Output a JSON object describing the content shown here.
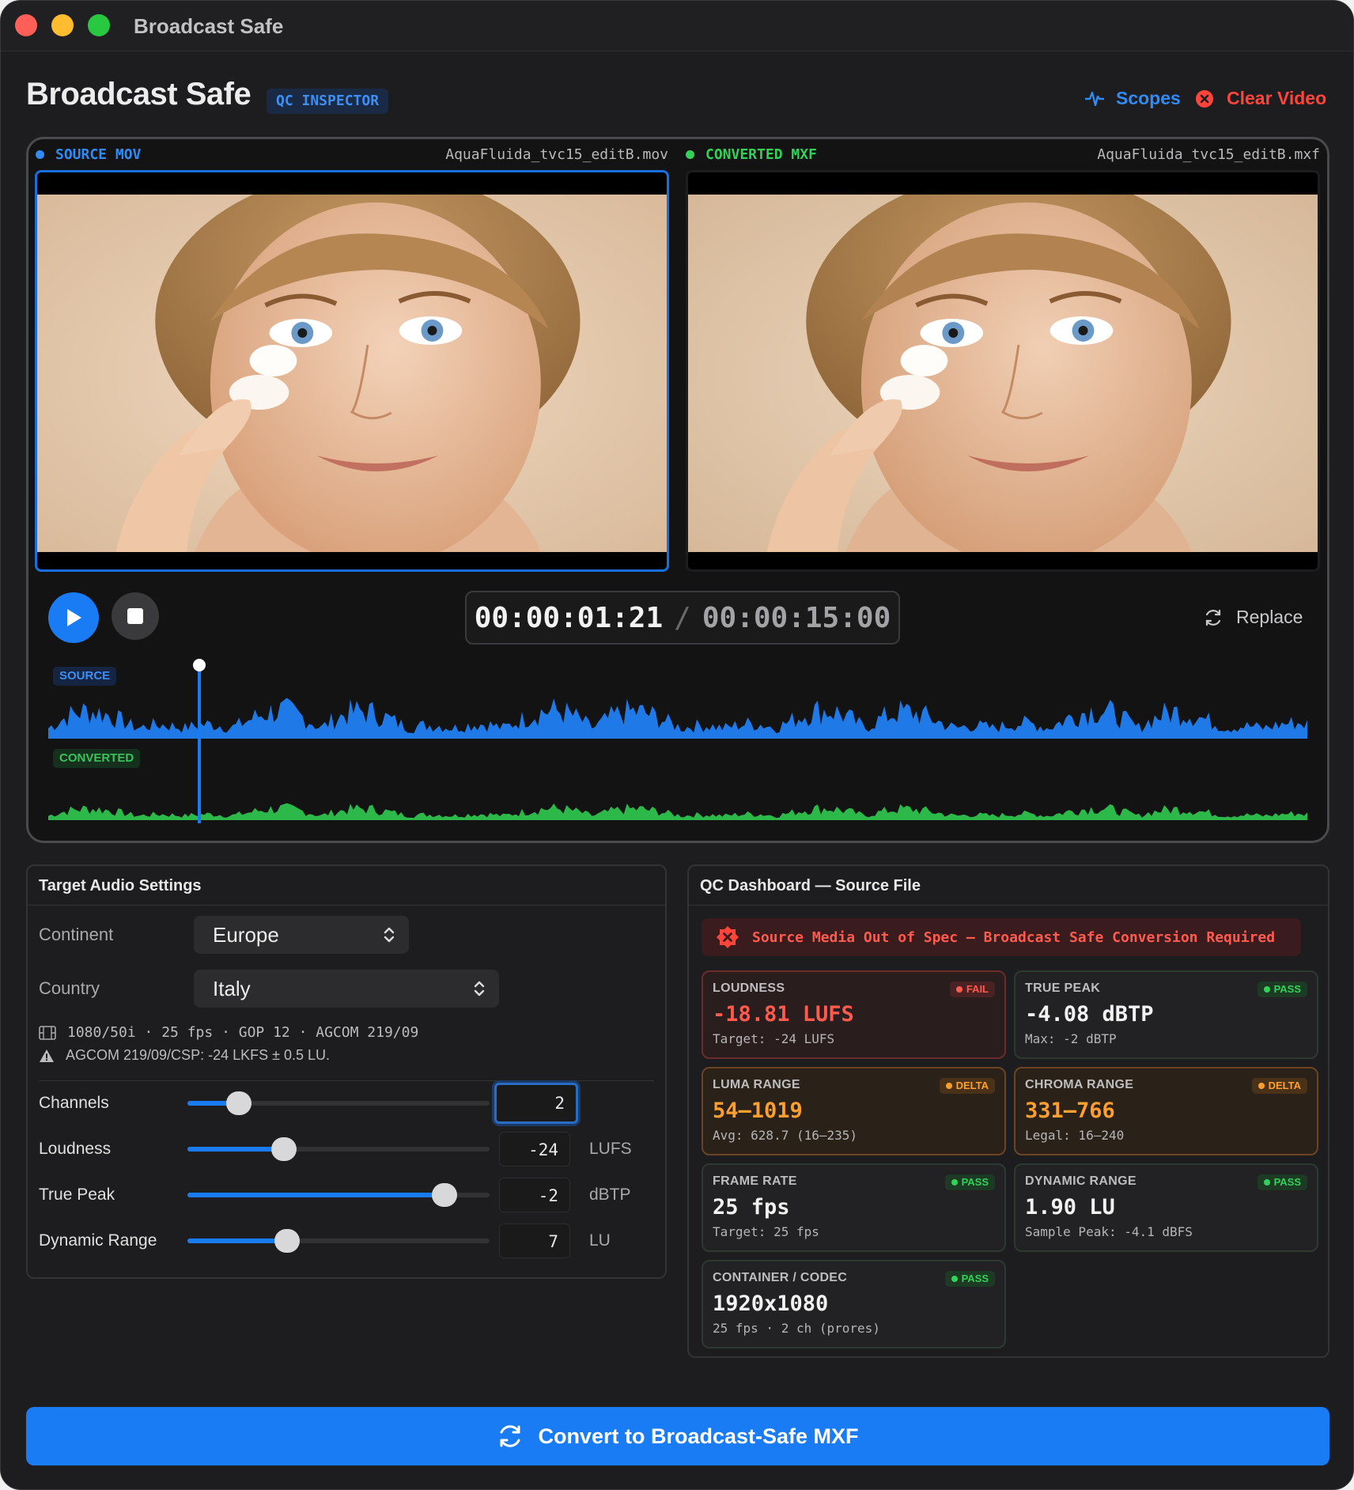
{
  "window": {
    "title": "Broadcast Safe"
  },
  "header": {
    "title": "Broadcast Safe",
    "badge": "QC INSPECTOR",
    "scopes_label": "Scopes",
    "clear_label": "Clear Video"
  },
  "viewer": {
    "source": {
      "label": "SOURCE MOV",
      "filename": "AquaFluida_tvc15_editB.mov"
    },
    "converted": {
      "label": "CONVERTED MXF",
      "filename": "AquaFluida_tvc15_editB.mxf"
    }
  },
  "transport": {
    "current_time": "00:00:01:21",
    "separator": "/",
    "duration": "00:00:15:00",
    "replace_label": "Replace",
    "playhead_fraction": 0.12
  },
  "waveforms": {
    "source_label": "SOURCE",
    "converted_label": "CONVERTED"
  },
  "audio_settings": {
    "title": "Target Audio Settings",
    "continent_label": "Continent",
    "continent_value": "Europe",
    "country_label": "Country",
    "country_value": "Italy",
    "spec_line": "1080/50i · 25 fps · GOP 12 · AGCOM 219/09",
    "warning_line": "AGCOM 219/09/CSP: -24 LKFS ± 0.5 LU.",
    "sliders": [
      {
        "label": "Channels",
        "value": "2",
        "unit": "",
        "fraction": 0.17
      },
      {
        "label": "Loudness",
        "value": "-24",
        "unit": "LUFS",
        "fraction": 0.32
      },
      {
        "label": "True Peak",
        "value": "-2",
        "unit": "dBTP",
        "fraction": 0.85
      },
      {
        "label": "Dynamic Range",
        "value": "7",
        "unit": "LU",
        "fraction": 0.33
      }
    ]
  },
  "qc": {
    "title": "QC Dashboard — Source File",
    "alert": "Source Media Out of Spec — Broadcast Safe Conversion Required",
    "cards": [
      {
        "title": "LOUDNESS",
        "status": "FAIL",
        "value": "-18.81 LUFS",
        "sub": "Target: -24 LUFS"
      },
      {
        "title": "TRUE PEAK",
        "status": "PASS",
        "value": "-4.08 dBTP",
        "sub": "Max: -2 dBTP"
      },
      {
        "title": "LUMA RANGE",
        "status": "DELTA",
        "value": "54–1019",
        "sub": "Avg: 628.7 (16–235)"
      },
      {
        "title": "CHROMA RANGE",
        "status": "DELTA",
        "value": "331–766",
        "sub": "Legal: 16–240"
      },
      {
        "title": "FRAME RATE",
        "status": "PASS",
        "value": "25 fps",
        "sub": "Target: 25 fps"
      },
      {
        "title": "DYNAMIC RANGE",
        "status": "PASS",
        "value": "1.90 LU",
        "sub": "Sample Peak: -4.1 dBFS"
      },
      {
        "title": "CONTAINER / CODEC",
        "status": "PASS",
        "value": "1920x1080",
        "sub": "25 fps · 2 ch (prores)"
      }
    ]
  },
  "convert_label": "Convert to Broadcast-Safe MXF",
  "colors": {
    "accent": "#1a7cf5",
    "source_wave": "#1f7ae8",
    "converted_wave": "#2db84a",
    "fail": "#ff453a",
    "delta": "#ff9f2e",
    "pass": "#32d158"
  },
  "icons": {
    "scopes": "waveform-icon",
    "clear": "close-circle-icon",
    "replace": "refresh-icon",
    "convert": "sync-icon",
    "play": "play-icon",
    "stop": "stop-icon",
    "film": "film-icon",
    "warning": "warning-icon",
    "alert": "error-icon"
  }
}
